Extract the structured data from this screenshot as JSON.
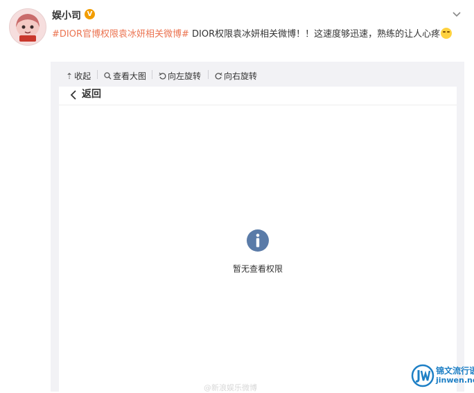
{
  "post": {
    "username": "娱小司",
    "verified_badge": "V",
    "topic": "#DIOR官博权限袁冰妍相关微博#",
    "text": " DIOR权限袁冰妍相关微博！！这速度够迅速，熟练的让人心疼"
  },
  "toolbar": {
    "collapse": "收起",
    "view_large": "查看大图",
    "rotate_left": "向左旋转",
    "rotate_right": "向右旋转"
  },
  "screenshot": {
    "back": "返回",
    "no_permission": "暂无查看权限",
    "faint_watermark": "@新浪娱乐微博"
  },
  "watermark": {
    "site_name": "锦文流行语",
    "site_url": "jinwen.net"
  },
  "colors": {
    "topic": "#eb7350",
    "info_icon": "#5a7ba8",
    "watermark": "#1d7fc5"
  },
  "icons": [
    "chevron-down-icon",
    "collapse-icon",
    "search-icon",
    "rotate-left-icon",
    "rotate-right-icon",
    "back-chevron-icon",
    "info-icon",
    "emoji-icon"
  ]
}
